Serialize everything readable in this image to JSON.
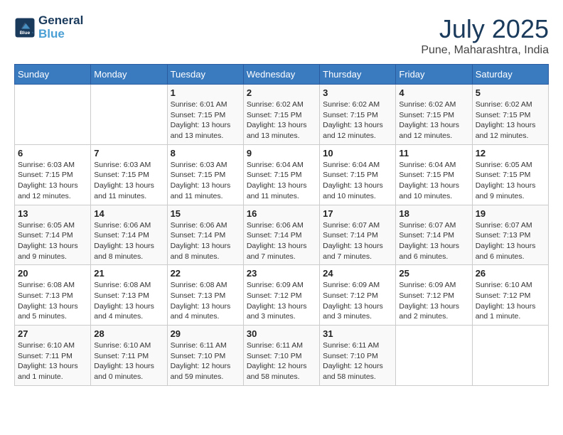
{
  "header": {
    "logo_line1": "General",
    "logo_line2": "Blue",
    "month": "July 2025",
    "location": "Pune, Maharashtra, India"
  },
  "weekdays": [
    "Sunday",
    "Monday",
    "Tuesday",
    "Wednesday",
    "Thursday",
    "Friday",
    "Saturday"
  ],
  "weeks": [
    [
      {
        "day": "",
        "info": ""
      },
      {
        "day": "",
        "info": ""
      },
      {
        "day": "1",
        "info": "Sunrise: 6:01 AM\nSunset: 7:15 PM\nDaylight: 13 hours\nand 13 minutes."
      },
      {
        "day": "2",
        "info": "Sunrise: 6:02 AM\nSunset: 7:15 PM\nDaylight: 13 hours\nand 13 minutes."
      },
      {
        "day": "3",
        "info": "Sunrise: 6:02 AM\nSunset: 7:15 PM\nDaylight: 13 hours\nand 12 minutes."
      },
      {
        "day": "4",
        "info": "Sunrise: 6:02 AM\nSunset: 7:15 PM\nDaylight: 13 hours\nand 12 minutes."
      },
      {
        "day": "5",
        "info": "Sunrise: 6:02 AM\nSunset: 7:15 PM\nDaylight: 13 hours\nand 12 minutes."
      }
    ],
    [
      {
        "day": "6",
        "info": "Sunrise: 6:03 AM\nSunset: 7:15 PM\nDaylight: 13 hours\nand 12 minutes."
      },
      {
        "day": "7",
        "info": "Sunrise: 6:03 AM\nSunset: 7:15 PM\nDaylight: 13 hours\nand 11 minutes."
      },
      {
        "day": "8",
        "info": "Sunrise: 6:03 AM\nSunset: 7:15 PM\nDaylight: 13 hours\nand 11 minutes."
      },
      {
        "day": "9",
        "info": "Sunrise: 6:04 AM\nSunset: 7:15 PM\nDaylight: 13 hours\nand 11 minutes."
      },
      {
        "day": "10",
        "info": "Sunrise: 6:04 AM\nSunset: 7:15 PM\nDaylight: 13 hours\nand 10 minutes."
      },
      {
        "day": "11",
        "info": "Sunrise: 6:04 AM\nSunset: 7:15 PM\nDaylight: 13 hours\nand 10 minutes."
      },
      {
        "day": "12",
        "info": "Sunrise: 6:05 AM\nSunset: 7:15 PM\nDaylight: 13 hours\nand 9 minutes."
      }
    ],
    [
      {
        "day": "13",
        "info": "Sunrise: 6:05 AM\nSunset: 7:14 PM\nDaylight: 13 hours\nand 9 minutes."
      },
      {
        "day": "14",
        "info": "Sunrise: 6:06 AM\nSunset: 7:14 PM\nDaylight: 13 hours\nand 8 minutes."
      },
      {
        "day": "15",
        "info": "Sunrise: 6:06 AM\nSunset: 7:14 PM\nDaylight: 13 hours\nand 8 minutes."
      },
      {
        "day": "16",
        "info": "Sunrise: 6:06 AM\nSunset: 7:14 PM\nDaylight: 13 hours\nand 7 minutes."
      },
      {
        "day": "17",
        "info": "Sunrise: 6:07 AM\nSunset: 7:14 PM\nDaylight: 13 hours\nand 7 minutes."
      },
      {
        "day": "18",
        "info": "Sunrise: 6:07 AM\nSunset: 7:14 PM\nDaylight: 13 hours\nand 6 minutes."
      },
      {
        "day": "19",
        "info": "Sunrise: 6:07 AM\nSunset: 7:13 PM\nDaylight: 13 hours\nand 6 minutes."
      }
    ],
    [
      {
        "day": "20",
        "info": "Sunrise: 6:08 AM\nSunset: 7:13 PM\nDaylight: 13 hours\nand 5 minutes."
      },
      {
        "day": "21",
        "info": "Sunrise: 6:08 AM\nSunset: 7:13 PM\nDaylight: 13 hours\nand 4 minutes."
      },
      {
        "day": "22",
        "info": "Sunrise: 6:08 AM\nSunset: 7:13 PM\nDaylight: 13 hours\nand 4 minutes."
      },
      {
        "day": "23",
        "info": "Sunrise: 6:09 AM\nSunset: 7:12 PM\nDaylight: 13 hours\nand 3 minutes."
      },
      {
        "day": "24",
        "info": "Sunrise: 6:09 AM\nSunset: 7:12 PM\nDaylight: 13 hours\nand 3 minutes."
      },
      {
        "day": "25",
        "info": "Sunrise: 6:09 AM\nSunset: 7:12 PM\nDaylight: 13 hours\nand 2 minutes."
      },
      {
        "day": "26",
        "info": "Sunrise: 6:10 AM\nSunset: 7:12 PM\nDaylight: 13 hours\nand 1 minute."
      }
    ],
    [
      {
        "day": "27",
        "info": "Sunrise: 6:10 AM\nSunset: 7:11 PM\nDaylight: 13 hours\nand 1 minute."
      },
      {
        "day": "28",
        "info": "Sunrise: 6:10 AM\nSunset: 7:11 PM\nDaylight: 13 hours\nand 0 minutes."
      },
      {
        "day": "29",
        "info": "Sunrise: 6:11 AM\nSunset: 7:10 PM\nDaylight: 12 hours\nand 59 minutes."
      },
      {
        "day": "30",
        "info": "Sunrise: 6:11 AM\nSunset: 7:10 PM\nDaylight: 12 hours\nand 58 minutes."
      },
      {
        "day": "31",
        "info": "Sunrise: 6:11 AM\nSunset: 7:10 PM\nDaylight: 12 hours\nand 58 minutes."
      },
      {
        "day": "",
        "info": ""
      },
      {
        "day": "",
        "info": ""
      }
    ]
  ]
}
